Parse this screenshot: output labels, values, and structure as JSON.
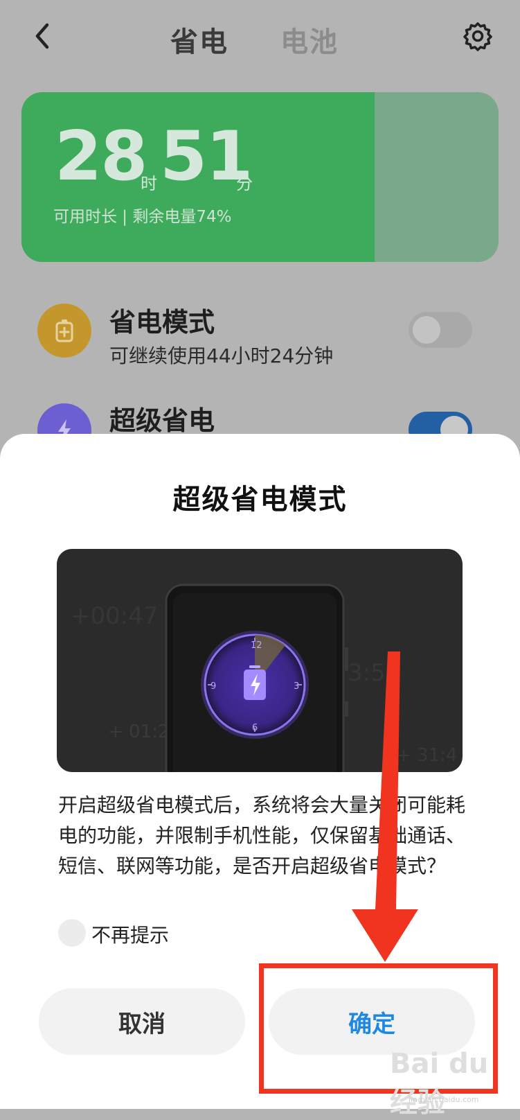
{
  "header": {
    "tab_active": "省电",
    "tab_inactive": "电池"
  },
  "battery": {
    "hours": "28",
    "hour_unit": "时",
    "minutes": "51",
    "minute_unit": "分",
    "subtitle": "可用时长 | 剩余电量74%",
    "level_percent": 74
  },
  "settings": [
    {
      "title": "省电模式",
      "subtitle": "可继续使用44小时24分钟",
      "enabled": false
    },
    {
      "title": "超级省电",
      "enabled": true
    }
  ],
  "dialog": {
    "title": "超级省电模式",
    "body": "开启超级省电模式后，系统将会大量关闭可能耗电的功能，并限制手机性能，仅保留基础通话、短信、联网等功能，是否开启超级省电模式？",
    "checkbox_label": "不再提示",
    "cancel_label": "取消",
    "confirm_label": "确定",
    "illustration": {
      "left_time_top": "+00:47",
      "left_time_bottom": "+ 01:2",
      "right_time": "3:50",
      "right_time_bottom": "+ 31:4",
      "clock_numbers": [
        "12",
        "3",
        "6",
        "9"
      ]
    }
  },
  "watermark": {
    "text": "Bai du 经验",
    "url": "jingyan.baidu.com"
  },
  "colors": {
    "card_green": "#3eaa5c",
    "power_saving_icon": "#c4972d",
    "super_saving_icon": "#6b5fd1",
    "confirm_blue": "#1e88e5",
    "annotation_red": "#f0341f"
  }
}
